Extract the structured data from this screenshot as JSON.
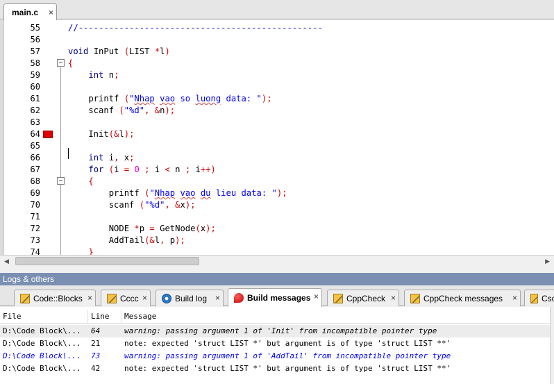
{
  "editor_tab": {
    "label": "main.c",
    "close": "×"
  },
  "code_lines": [
    {
      "n": "55",
      "html": "<span class=\"cm\">//------------------------------------------------</span>"
    },
    {
      "n": "56",
      "html": ""
    },
    {
      "n": "57",
      "html": "<span class=\"kw\">void</span> InPut <span class=\"op\">(</span>LIST <span class=\"op\">*</span>l<span class=\"op\">)</span>"
    },
    {
      "n": "58",
      "html": "<span class=\"op\">{</span>"
    },
    {
      "n": "59",
      "html": "    <span class=\"kw\">int</span> n<span class=\"op\">;</span>"
    },
    {
      "n": "60",
      "html": ""
    },
    {
      "n": "61",
      "html": "    printf <span class=\"op\">(</span><span class=\"st\">\"<span class=\"sq\">Nhap</span> <span class=\"sq\">vao</span> so <span class=\"sq\">luong</span> data: \"</span><span class=\"op\">);</span>"
    },
    {
      "n": "62",
      "html": "    scanf <span class=\"op\">(</span><span class=\"st\">\"%d\"</span><span class=\"op\">,</span> <span class=\"op\">&amp;</span>n<span class=\"op\">);</span>"
    },
    {
      "n": "63",
      "html": ""
    },
    {
      "n": "64",
      "html": "    Init<span class=\"op\">(&amp;</span>l<span class=\"op\">);</span>"
    },
    {
      "n": "65",
      "html": ""
    },
    {
      "n": "66",
      "html": "    <span class=\"kw\">int</span> i<span class=\"op\">,</span> x<span class=\"op\">;</span>"
    },
    {
      "n": "67",
      "html": "    <span class=\"kw\">for</span> <span class=\"op\">(</span>i <span class=\"op\">=</span> <span class=\"num\">0</span> <span class=\"op\">;</span> i <span class=\"op\">&lt;</span> n <span class=\"op\">;</span> i<span class=\"op\">++)</span>"
    },
    {
      "n": "68",
      "html": "    <span class=\"op\">{</span>"
    },
    {
      "n": "69",
      "html": "        printf <span class=\"op\">(</span><span class=\"st\">\"<span class=\"sq\">Nhap</span> <span class=\"sq\">vao</span> <span class=\"sq\">du</span> lieu data: \"</span><span class=\"op\">);</span>"
    },
    {
      "n": "70",
      "html": "        scanf <span class=\"op\">(</span><span class=\"st\">\"%d\"</span><span class=\"op\">,</span> <span class=\"op\">&amp;</span>x<span class=\"op\">);</span>"
    },
    {
      "n": "71",
      "html": ""
    },
    {
      "n": "72",
      "html": "        NODE <span class=\"op\">*</span>p <span class=\"op\">=</span> GetNode<span class=\"op\">(</span>x<span class=\"op\">);</span>"
    },
    {
      "n": "73",
      "html": "        AddTail<span class=\"op\">(&amp;</span>l<span class=\"op\">,</span> p<span class=\"op\">);</span>"
    },
    {
      "n": "74",
      "html": "    <span class=\"op\">}</span>"
    }
  ],
  "logs_panel": {
    "title": "Logs & others"
  },
  "log_tabs": [
    {
      "label": "Code::Blocks",
      "icon": "pencil-icon",
      "active": false
    },
    {
      "label": "Cccc",
      "icon": "pencil-icon",
      "active": false
    },
    {
      "label": "Build log",
      "icon": "gear-icon",
      "active": false
    },
    {
      "label": "Build messages",
      "icon": "pin-icon",
      "active": true
    },
    {
      "label": "CppCheck",
      "icon": "pencil-icon",
      "active": false
    },
    {
      "label": "CppCheck messages",
      "icon": "pencil-icon",
      "active": false
    },
    {
      "label": "Cscop",
      "icon": "pencil-icon",
      "active": false
    }
  ],
  "messages": {
    "columns": [
      "File",
      "Line",
      "Message"
    ],
    "rows": [
      {
        "file": "D:\\Code Block\\...",
        "line": "64",
        "message": "warning: passing argument 1 of 'Init' from incompatible pointer type",
        "kind": "warning",
        "selected": true
      },
      {
        "file": "D:\\Code Block\\...",
        "line": "21",
        "message": "note: expected 'struct LIST *' but argument is of type 'struct LIST **'",
        "kind": "note",
        "selected": false
      },
      {
        "file": "D:\\Code Block\\...",
        "line": "73",
        "message": "warning: passing argument 1 of 'AddTail' from incompatible pointer type",
        "kind": "warning-blue",
        "selected": false
      },
      {
        "file": "D:\\Code Block\\...",
        "line": "42",
        "message": "note: expected 'struct LIST *' but argument is of type 'struct LIST **'",
        "kind": "note",
        "selected": false
      }
    ]
  }
}
